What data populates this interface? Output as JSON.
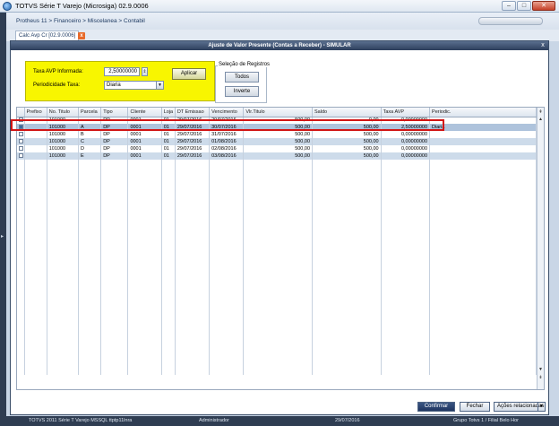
{
  "window": {
    "title": "TOTVS Série T Varejo (Microsiga) 02.9.0006",
    "minimize": "–",
    "maximize": "□",
    "close": "✕"
  },
  "breadcrumb": "Protheus 11 > Financeiro > Miscelanea > Contabil",
  "tab": {
    "label": "Calc Avp Cr [02.9.0006]",
    "close": "x"
  },
  "dialog": {
    "title": "Ajuste de Valor Presente (Contas a Receber) - SIMULAR",
    "close": "x",
    "params": {
      "rate_label": "Taxa AVP Informada:",
      "rate_value": "2,50000000",
      "period_label": "Periodicidade Taxa:",
      "period_value": "Diaria",
      "apply_label": "Aplicar"
    },
    "selection": {
      "title": "Seleção de Registros",
      "all_label": "Todos",
      "invert_label": "Inverte"
    }
  },
  "grid": {
    "columns": [
      "",
      "Prefixo",
      "No. Titulo",
      "Parcela",
      "Tipo",
      "Cliente",
      "Loja",
      "DT Emissao",
      "Vencimento",
      "Vlr.Titulo",
      "Saldo",
      "Taxa AVP",
      "Periodic."
    ],
    "rows": [
      {
        "checked": false,
        "prefixo": "",
        "titulo": "101000",
        "parcela": "",
        "tipo": "DP",
        "cliente": "0001",
        "loja": "01",
        "emissao": "29/07/2016",
        "vencimento": "29/07/2016",
        "valor": "500,00",
        "saldo": "0,00",
        "taxa": "0,00000000",
        "periodic": ""
      },
      {
        "checked": true,
        "prefixo": "",
        "titulo": "101000",
        "parcela": "A",
        "tipo": "DP",
        "cliente": "0001",
        "loja": "01",
        "emissao": "29/07/2016",
        "vencimento": "30/07/2016",
        "valor": "500,00",
        "saldo": "500,00",
        "taxa": "2,50000000",
        "periodic": "Diaria"
      },
      {
        "checked": false,
        "prefixo": "",
        "titulo": "101000",
        "parcela": "B",
        "tipo": "DP",
        "cliente": "0001",
        "loja": "01",
        "emissao": "29/07/2016",
        "vencimento": "31/07/2016",
        "valor": "500,00",
        "saldo": "500,00",
        "taxa": "0,00000000",
        "periodic": ""
      },
      {
        "checked": false,
        "prefixo": "",
        "titulo": "101000",
        "parcela": "C",
        "tipo": "DP",
        "cliente": "0001",
        "loja": "01",
        "emissao": "29/07/2016",
        "vencimento": "01/08/2016",
        "valor": "500,00",
        "saldo": "500,00",
        "taxa": "0,00000000",
        "periodic": ""
      },
      {
        "checked": false,
        "prefixo": "",
        "titulo": "101000",
        "parcela": "D",
        "tipo": "DP",
        "cliente": "0001",
        "loja": "01",
        "emissao": "29/07/2016",
        "vencimento": "02/08/2016",
        "valor": "500,00",
        "saldo": "500,00",
        "taxa": "0,00000000",
        "periodic": ""
      },
      {
        "checked": false,
        "prefixo": "",
        "titulo": "101000",
        "parcela": "E",
        "tipo": "DP",
        "cliente": "0001",
        "loja": "01",
        "emissao": "29/07/2016",
        "vencimento": "03/08/2016",
        "valor": "500,00",
        "saldo": "500,00",
        "taxa": "0,00000000",
        "periodic": ""
      }
    ]
  },
  "buttons": {
    "confirm": "Confirmar",
    "close": "Fechar",
    "related": "Ações relacionadas"
  },
  "status": {
    "system": "TOTVS 2011 Série T Varejo MSSQL ttptp11lnra",
    "user": "Administrador",
    "date": "29/07/2016",
    "branch": "Grupo Totvs 1 / Filial Belo Hor"
  },
  "colors": {
    "highlight_box": "#d21414",
    "param_bg": "#f8f600",
    "title_bar": "#2d3f5c"
  }
}
